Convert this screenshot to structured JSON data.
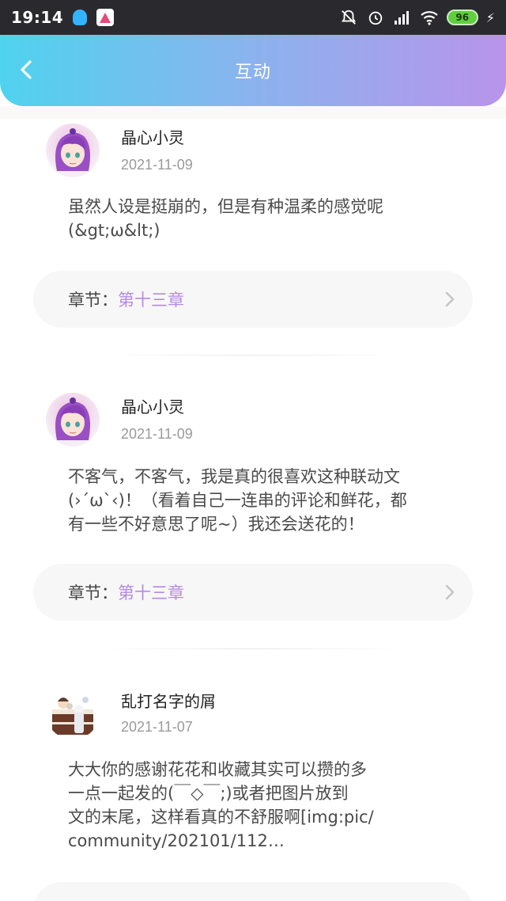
{
  "status_bar": {
    "time": "19:14",
    "battery": "96"
  },
  "header": {
    "title": "互动"
  },
  "comments": [
    {
      "username": "晶心小灵",
      "date": "2021-11-09",
      "text_lines": [
        "虽然人设是挺崩的，但是有种温柔的感觉呢",
        "(&gt;ω&lt;)"
      ],
      "chapter_label": "章节：",
      "chapter_value": "第十三章"
    },
    {
      "username": "晶心小灵",
      "date": "2021-11-09",
      "text_lines": [
        "不客气，不客气，我是真的很喜欢这种联动文",
        "(›´ω`‹)！（看着自己一连串的评论和鲜花，都",
        "有一些不好意思了呢~）我还会送花的！"
      ],
      "chapter_label": "章节：",
      "chapter_value": "第十三章"
    },
    {
      "username": "乱打名字的屑",
      "date": "2021-11-07",
      "text_lines": [
        "大大你的感谢花花和收藏其实可以攒的多",
        "一点一起发的(￣◇￣;)或者把图片放到",
        "文的末尾，这样看真的不舒服啊[img:pic/",
        "community/202101/112…"
      ]
    }
  ],
  "colors": {
    "header_start": "#4fd3ee",
    "header_end": "#b894ea",
    "chapter_accent": "#b58be0"
  },
  "icons": [
    "back-arrow-icon",
    "chevron-right-icon",
    "bell-off-icon",
    "alarm-icon",
    "signal-icon",
    "wifi-icon",
    "battery-icon",
    "charging-icon"
  ]
}
